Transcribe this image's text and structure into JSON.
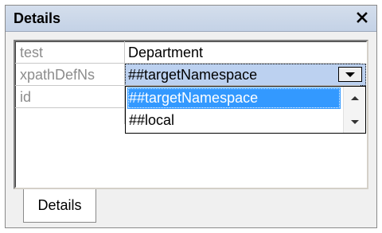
{
  "window": {
    "title": "Details",
    "close_icon": "close-icon"
  },
  "properties": [
    {
      "key": "test",
      "value": "Department"
    },
    {
      "key": "xpathDefNs",
      "value": "##targetNamespace"
    },
    {
      "key": "id",
      "value": ""
    }
  ],
  "dropdown": {
    "options": [
      "##targetNamespace",
      "##local"
    ],
    "selected": "##targetNamespace"
  },
  "tabs": [
    {
      "label": "Details",
      "active": true
    }
  ],
  "colors": {
    "titlebar": "#c4d2e6",
    "selection": "#3399ff",
    "combo_highlight": "#bcd1f0"
  }
}
